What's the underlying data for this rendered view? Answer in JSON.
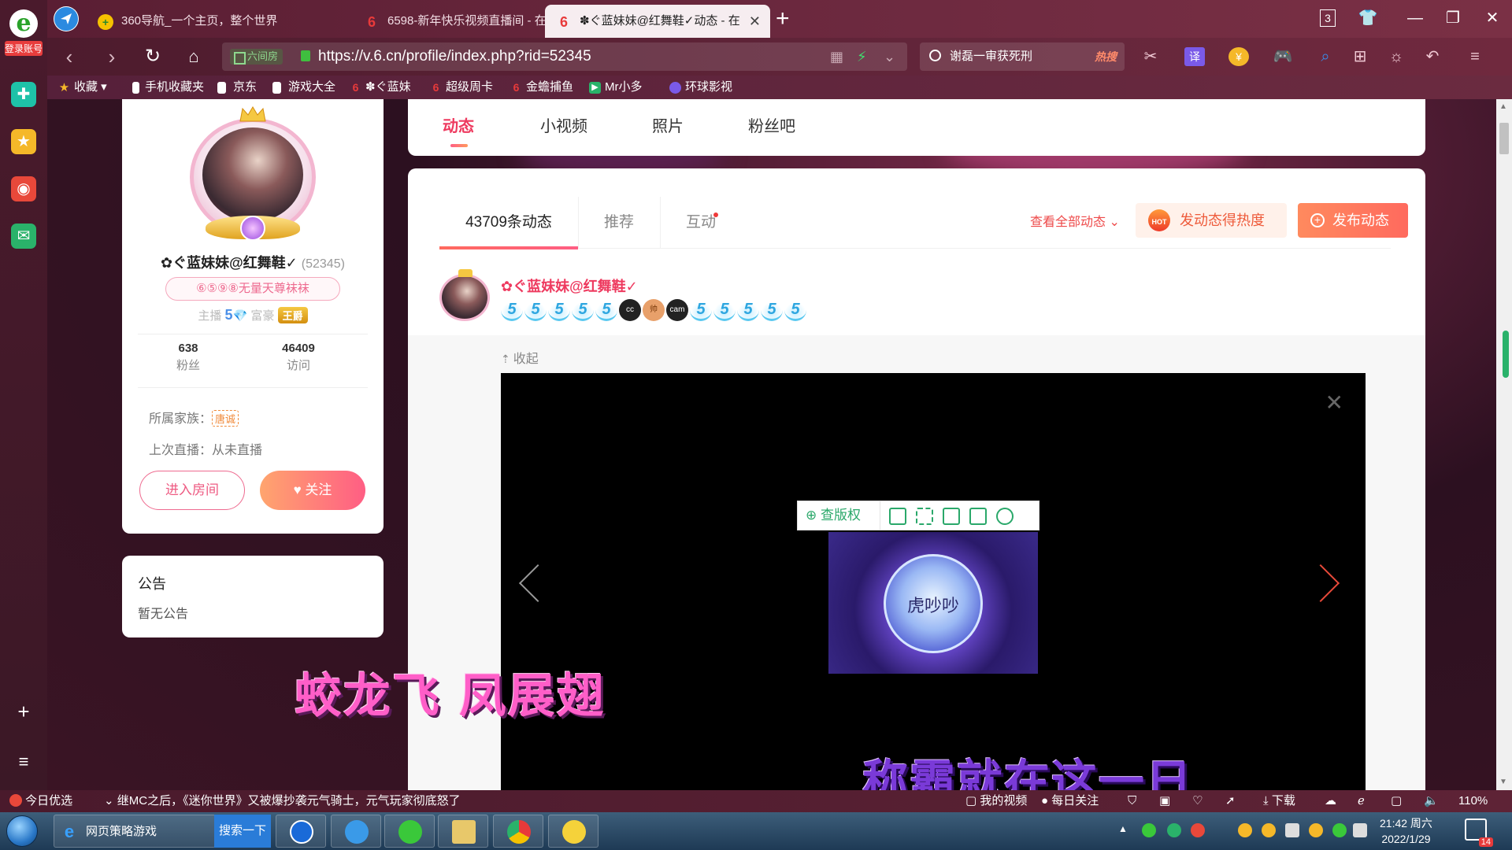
{
  "sidebar": {
    "login_label": "登录账号",
    "plus_label": "+",
    "list_label": "≡"
  },
  "tabs": [
    {
      "title": "360导航_一个主页，整个世界",
      "active": false
    },
    {
      "title": "6598-新年快乐视频直播间 - 在",
      "active": false
    },
    {
      "title": "✽ぐ蓝妹妹@红舞鞋✓动态 - 在",
      "active": true
    }
  ],
  "window": {
    "tab_count": "3"
  },
  "address": {
    "security_label": "六间房",
    "url": "https://v.6.cn/profile/index.php?rid=52345"
  },
  "search": {
    "query": "谢磊一审获死刑",
    "hot_label": "热搜"
  },
  "bookmarks": [
    {
      "label": "收藏",
      "icon": "star-icon",
      "color": "#f5b829"
    },
    {
      "label": "手机收藏夹",
      "icon": "phone-icon",
      "color": "#ffffff"
    },
    {
      "label": "京东",
      "icon": "page-icon",
      "color": "#ffffff"
    },
    {
      "label": "游戏大全",
      "icon": "page-icon",
      "color": "#ffffff"
    },
    {
      "label": "✽ぐ蓝妹",
      "icon": "six-icon",
      "color": "#e83a3a"
    },
    {
      "label": "超级周卡",
      "icon": "six-icon",
      "color": "#e83a3a"
    },
    {
      "label": "金蟾捕鱼",
      "icon": "six-icon",
      "color": "#e83a3a"
    },
    {
      "label": "Mr小多",
      "icon": "mr-icon",
      "color": "#2ab26a"
    },
    {
      "label": "环球影视",
      "icon": "globe-icon",
      "color": "#7a5ae8"
    }
  ],
  "top_tabs": [
    {
      "label": "动态",
      "active": true
    },
    {
      "label": "小视频",
      "active": false
    },
    {
      "label": "照片",
      "active": false
    },
    {
      "label": "粉丝吧",
      "active": false
    }
  ],
  "profile": {
    "name": "✿ぐ蓝妹妹@红舞鞋✓",
    "rid": "(52345)",
    "tag": "⑥⑤⑨⑧无量天尊袜袜",
    "anchor_label": "主播",
    "anchor_level": "5",
    "rich_label": "富豪",
    "rich_badge": "王爵",
    "fans_count": "638",
    "fans_label": "粉丝",
    "visits_count": "46409",
    "visits_label": "访问",
    "family_label": "所属家族：",
    "family_value": "唐诚",
    "last_live": "上次直播：从未直播",
    "enter_room_label": "进入房间",
    "follow_label": "关注"
  },
  "notice": {
    "title": "公告",
    "content": "暂无公告"
  },
  "feed": {
    "tabs": [
      {
        "label": "43709条动态",
        "active": true
      },
      {
        "label": "推荐",
        "active": false
      },
      {
        "label": "互动",
        "active": false,
        "dot": true
      }
    ],
    "view_all_label": "查看全部动态",
    "boost_label": "发动态得热度",
    "boost_icon_text": "HOT",
    "publish_label": "发布动态"
  },
  "post": {
    "author": "✿ぐ蓝妹妹@红舞鞋✓",
    "badges": [
      "5",
      "5",
      "5",
      "5",
      "5",
      "cc",
      "帅",
      "cam",
      "5",
      "5",
      "5",
      "5",
      "5"
    ],
    "collapse_label": "收起",
    "copyright_label": "查版权",
    "thumb_text": "虎吵吵"
  },
  "overlay": {
    "line1": "蛟龙飞  凤展翅",
    "line2": "称霸就在这一日"
  },
  "statusbar": {
    "today_pick": "今日优选",
    "headline": "继MC之后，《迷你世界》又被爆抄袭元气骑士，元气玩家彻底怒了",
    "my_video": "我的视频",
    "daily_follow": "每日关注",
    "download": "下载",
    "zoom": "110%"
  },
  "taskbar": {
    "task_title": "网页策略游戏",
    "search_label": "搜索一下",
    "time": "21:42 周六",
    "date": "2022/1/29",
    "notif_count": "14"
  }
}
